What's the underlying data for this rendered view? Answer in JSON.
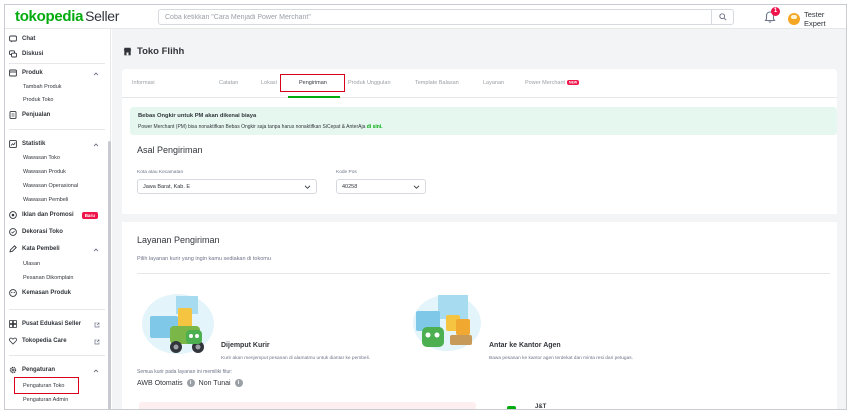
{
  "header": {
    "logo_main": "tokopedia",
    "logo_sub": "Seller",
    "search_placeholder": "Coba ketikkan \"Cara Menjadi Power Merchant\"",
    "notif_count": "1",
    "user_name": "Tester Expert"
  },
  "sidebar": {
    "chat": "Chat",
    "diskusi": "Diskusi",
    "produk": "Produk",
    "tambah_produk": "Tambah Produk",
    "produk_toko": "Produk Toko",
    "penjualan": "Penjualan",
    "statistik": "Statistik",
    "wawasan_toko": "Wawasan Toko",
    "wawasan_produk": "Wawasan Produk",
    "wawasan_operasional": "Wawasan Operasional",
    "wawasan_pembeli": "Wawasan Pembeli",
    "iklan": "Iklan dan Promosi",
    "iklan_badge": "Baru",
    "dekorasi": "Dekorasi Toko",
    "kata_pembeli": "Kata Pembeli",
    "ulasan": "Ulasan",
    "pesanan_dikomplain": "Pesanan Dikomplain",
    "kemasan": "Kemasan Produk",
    "pusat_edukasi": "Pusat Edukasi Seller",
    "tokopedia_care": "Tokopedia Care",
    "pengaturan": "Pengaturan",
    "pengaturan_toko": "Pengaturan Toko",
    "pengaturan_admin": "Pengaturan Admin"
  },
  "page": {
    "title": "Toko Flihh"
  },
  "tabs": [
    {
      "label": "Informasi"
    },
    {
      "label": "Catatan"
    },
    {
      "label": "Lokasi"
    },
    {
      "label": "Pengiriman"
    },
    {
      "label": "Produk Unggulan"
    },
    {
      "label": "Template Balasan"
    },
    {
      "label": "Layanan"
    },
    {
      "label": "Power Merchant"
    }
  ],
  "tab_new_badge": "NEW",
  "banner": {
    "title": "Bebas Ongkir untuk PM akan dikenai biaya",
    "text": "Power Merchant (PM) bisa nonaktifkan Bebas Ongkir saja tanpa harus nonaktifkan SiCepat & AnterAja",
    "link": "di sini."
  },
  "asal": {
    "title": "Asal Pengiriman",
    "kota_label": "Kota atau Kecamatan",
    "kota_value": "Jawa Barat, Kab. E",
    "kodepos_label": "Kode Pos",
    "kodepos_value": "40258"
  },
  "layanan": {
    "title": "Layanan Pengiriman",
    "desc": "Pilih layanan kurir yang ingin kamu sediakan di tokomu",
    "opt1_title": "Dijemput Kurir",
    "opt1_desc": "Kurir akan menjemput pesanan di alamatmu untuk diantar ke pembeli.",
    "opt2_title": "Antar ke Kantor Agen",
    "opt2_desc": "Bawa pesanan ke kantor agen terdekat dan minta resi dari petugas.",
    "features_label": "Semua kurir pada layanan ini memiliki fitur:",
    "feature1": "AWB Otomatis",
    "feature2": "Non Tunai",
    "courier": "J&T"
  },
  "colors": {
    "brand_green": "#03ac0e",
    "highlight_red": "#d6001c",
    "banner_bg": "#e6f7ef"
  }
}
